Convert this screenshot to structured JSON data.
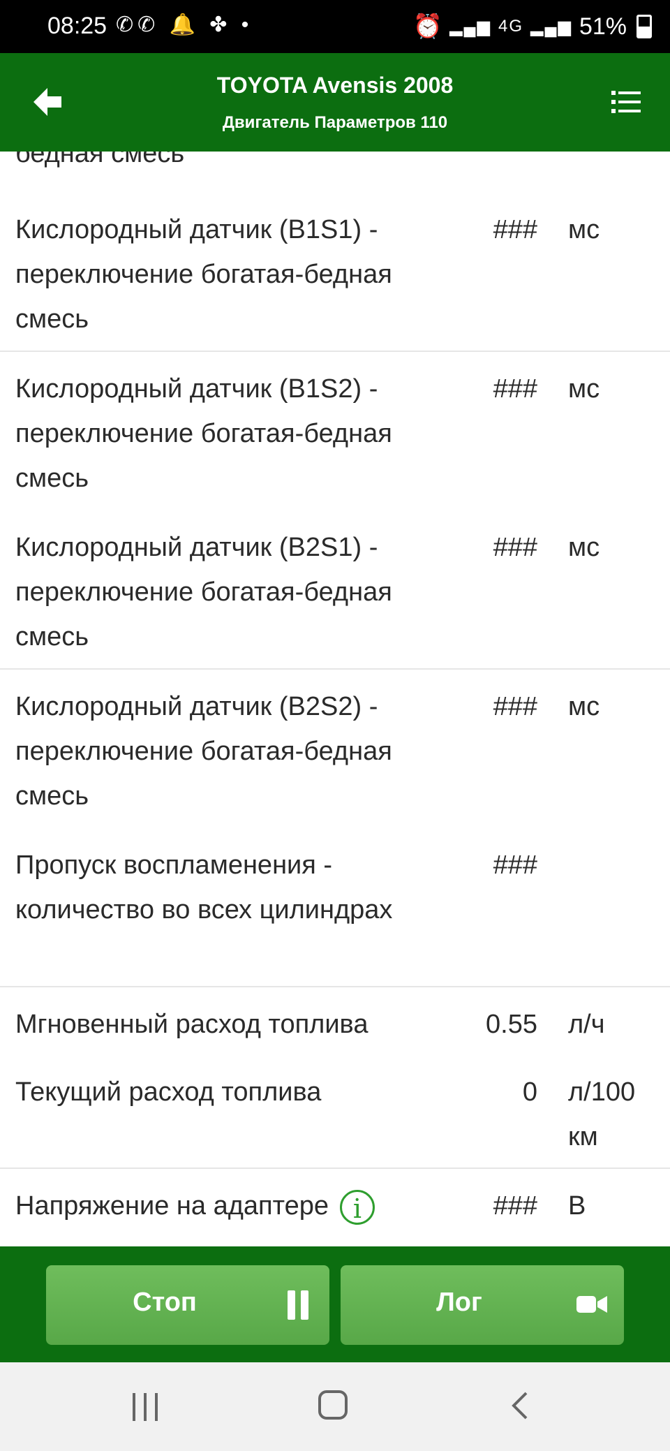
{
  "status_bar": {
    "time": "08:25",
    "left_icons": "✆✆ 🔔 ✤ •",
    "network": "4G",
    "battery_percent": "51%"
  },
  "toolbar": {
    "title": "TOYOTA Avensis 2008",
    "subtitle": "Двигатель Параметров 110",
    "back_icon": "arrow-left-icon",
    "menu_icon": "list-icon"
  },
  "partial_row_text": "бедная смесь",
  "rows": [
    {
      "name": "Кислородный датчик (B1S1) - переключение богатая-бедная смесь",
      "value": "###",
      "unit": "мс"
    },
    {
      "name": "Кислородный датчик (B1S2) - переключение богатая-бедная смесь",
      "value": "###",
      "unit": "мс"
    },
    {
      "name": "Кислородный датчик (B2S1) - переключение богатая-бедная смесь",
      "value": "###",
      "unit": "мс"
    },
    {
      "name": "Кислородный датчик (B2S2) - переключение богатая-бедная смесь",
      "value": "###",
      "unit": "мс"
    },
    {
      "name": "Пропуск воспламенения - количество во всех цилиндрах",
      "value": "###",
      "unit": ""
    },
    {
      "name": "Мгновенный расход топлива",
      "value": "0.55",
      "unit": "л/ч"
    },
    {
      "name": "Текущий расход топлива",
      "value": "0",
      "unit": "л/100 км"
    },
    {
      "name": "Напряжение на адаптере",
      "value": "###",
      "unit": "В",
      "info": "i"
    }
  ],
  "actions": {
    "stop_label": "Стоп",
    "log_label": "Лог"
  },
  "colors": {
    "primary": "#0c6e10",
    "button": "#5fae4e",
    "info": "#2e9e2e"
  }
}
